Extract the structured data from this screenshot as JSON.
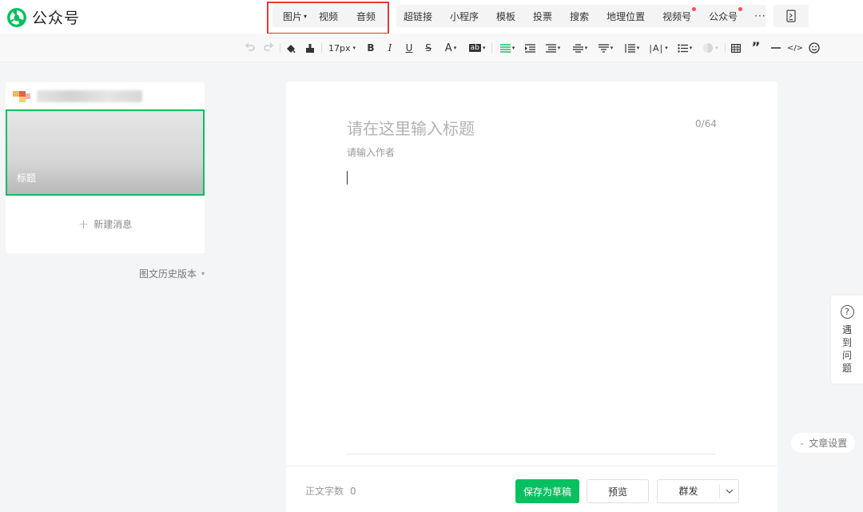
{
  "header": {
    "app_name": "公众号",
    "brand_color": "#07c160",
    "insert_primary": [
      {
        "label": "图片",
        "has_dropdown": true
      },
      {
        "label": "视频"
      },
      {
        "label": "音频"
      }
    ],
    "insert_secondary": [
      {
        "label": "超链接"
      },
      {
        "label": "小程序"
      },
      {
        "label": "模板"
      },
      {
        "label": "投票"
      },
      {
        "label": "搜索"
      },
      {
        "label": "地理位置"
      },
      {
        "label": "视频号",
        "badge": true
      },
      {
        "label": "公众号",
        "badge": true
      }
    ],
    "more_label": "···"
  },
  "toolbar": {
    "font_size": "17px",
    "bold": "B",
    "italic": "I",
    "underline": "U",
    "strike": "S",
    "font_color": "A",
    "bg_color": "ab"
  },
  "left_panel": {
    "cover_title": "标题",
    "new_message": "新建消息",
    "history": "图文历史版本"
  },
  "editor": {
    "title_placeholder": "请在这里输入标题",
    "title_counter": "0/64",
    "author_placeholder": "请输入作者"
  },
  "footer": {
    "word_count_label": "正文字数",
    "word_count_value": "0",
    "save_draft": "保存为草稿",
    "preview": "预览",
    "send": "群发"
  },
  "side": {
    "help_icon": "?",
    "help_label": "遇到问题",
    "article_settings": "文章设置"
  }
}
